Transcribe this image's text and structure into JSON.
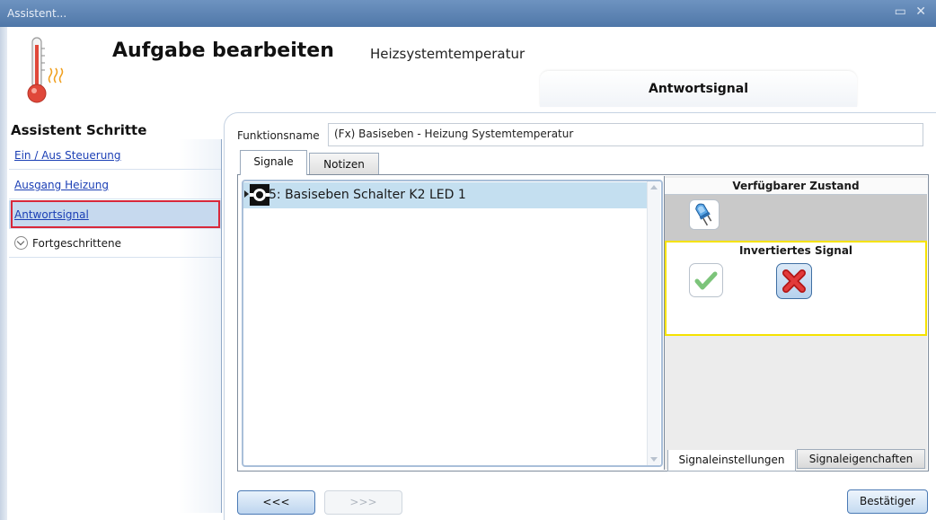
{
  "window": {
    "title": "Assistent...",
    "controls": "▭ ✕"
  },
  "header": {
    "title": "Aufgabe bearbeiten",
    "subtitle": "Heizsystemtemperatur",
    "icon": "thermometer-heat-icon",
    "current_step": "Antwortsignal"
  },
  "sidebar": {
    "title": "Assistent Schritte",
    "items": [
      {
        "label": "Ein / Aus Steuerung",
        "type": "link"
      },
      {
        "label": "Ausgang Heizung",
        "type": "link"
      },
      {
        "label": "Antwortsignal",
        "type": "link",
        "active": true
      },
      {
        "label": "Fortgeschrittene",
        "type": "expander"
      }
    ]
  },
  "function": {
    "label": "Funktionsname",
    "value": "(Fx) Basiseben - Heizung Systemtemperatur"
  },
  "tabs": [
    {
      "label": "Signale",
      "selected": true
    },
    {
      "label": "Notizen",
      "selected": false
    }
  ],
  "signals": [
    {
      "label": "5: Basiseben Schalter K2 LED 1",
      "icon": "led-signal-icon",
      "selected": true
    }
  ],
  "right_panel": {
    "available_state_header": "Verfügbarer Zustand",
    "available_state_icon": "led-bulb-icon",
    "inverted_signal_header": "Invertiertes Signal",
    "inverted_options": [
      {
        "name": "ja",
        "icon": "check-icon",
        "selected": false
      },
      {
        "name": "nein",
        "icon": "cross-icon",
        "selected": true
      }
    ],
    "highlight_color": "#f5e200",
    "bottom_tabs": [
      {
        "label": "Signaleinstellungen",
        "selected": true
      },
      {
        "label": "Signaleigenchaften",
        "selected": false
      }
    ]
  },
  "footer": {
    "prev_label": "<<<",
    "next_label": ">>>",
    "confirm_label": "Bestätiger"
  },
  "colors": {
    "titlebar": "#5a80b0",
    "sidebar_highlight": "#d8283a",
    "selected_row": "#c4dff0",
    "link": "#1b3fb5"
  }
}
